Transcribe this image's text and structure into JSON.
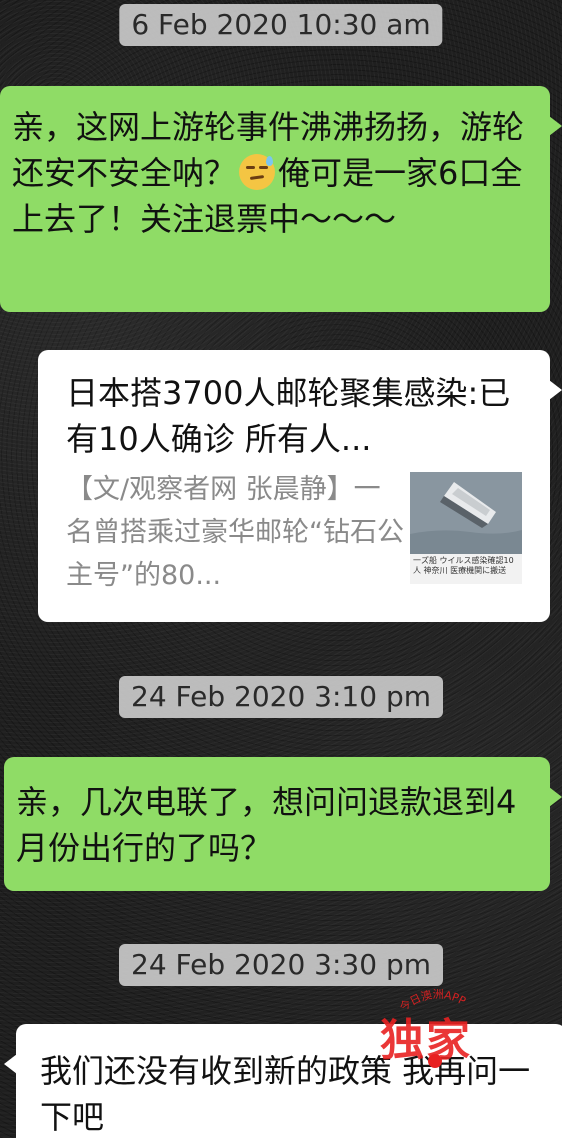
{
  "messages": [
    {
      "type": "timestamp",
      "text": "6 Feb 2020 10:30 am"
    },
    {
      "type": "outgoing",
      "text_before": "亲，这网上游轮事件沸沸扬扬，游轮还安不安全呐？",
      "emoji": "sweat-smile-emoji",
      "text_after": "俺可是一家6口全上去了！关注退票中～～～"
    },
    {
      "type": "link-card",
      "title": "日本搭3700人邮轮聚集感染:已有10人确诊 所有人...",
      "description": "【文/观察者网 张晨静】一名曾搭乘过豪华邮轮“钻石公主号”的80...",
      "thumbnail_caption": "一ズ船 ウイルス感染確認10人 神奈川 医療機関に搬送"
    },
    {
      "type": "timestamp",
      "text": "24 Feb 2020 3:10 pm"
    },
    {
      "type": "outgoing",
      "text": "亲，几次电联了，想问问退款退到4月份出行的了吗？"
    },
    {
      "type": "timestamp",
      "text": "24 Feb 2020 3:30 pm"
    },
    {
      "type": "incoming",
      "text": "我们还没有收到新的政策 我再问一下吧"
    }
  ],
  "watermark": {
    "ring_text": "今日澳洲APP",
    "main_text": "独家"
  },
  "colors": {
    "outgoing_bubble": "#8fdc66",
    "incoming_bubble": "#ffffff",
    "timestamp_bg": "#d2d2d2",
    "watermark": "#e82121"
  }
}
